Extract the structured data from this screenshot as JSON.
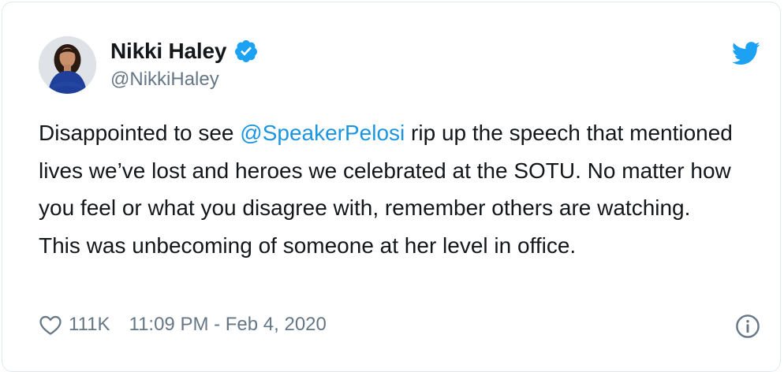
{
  "author": {
    "name": "Nikki Haley",
    "handle": "@NikkiHaley",
    "verified": true
  },
  "tweet": {
    "text_before_mention": "Disappointed to see ",
    "mention": "@SpeakerPelosi",
    "text_after_mention": " rip up the speech that mentioned lives we’ve lost and heroes we celebrated at the SOTU. No matter how you feel or what you disagree with, remember others are watching. This was unbecoming of someone at her level in office."
  },
  "footer": {
    "like_count": "111K",
    "timestamp": "11:09 PM - Feb 4, 2020"
  },
  "icons": {
    "brand": "twitter-bird-icon",
    "verified": "verified-badge-icon",
    "like": "heart-icon",
    "info": "info-icon"
  },
  "colors": {
    "twitter_blue": "#1da1f2",
    "link_blue": "#1b95e0",
    "text": "#14171a",
    "secondary_text": "#657786",
    "border": "#e1e8ed"
  }
}
